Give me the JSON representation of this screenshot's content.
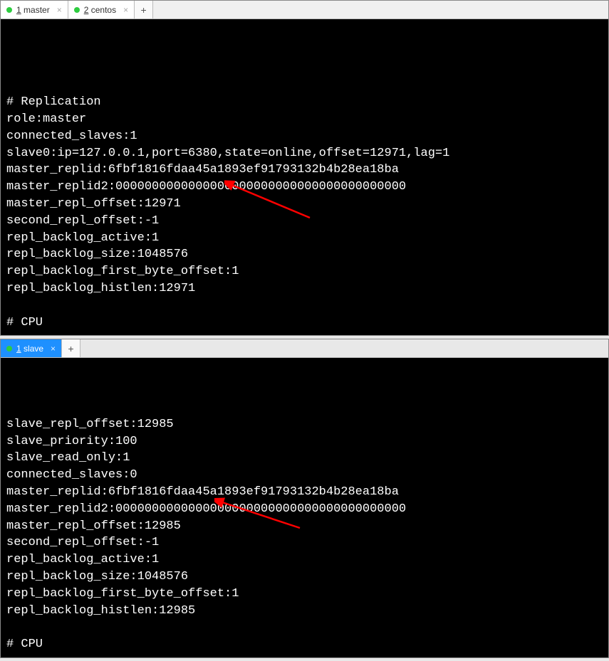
{
  "top": {
    "tabs": [
      {
        "label": "1 master"
      },
      {
        "label": "2 centos"
      }
    ],
    "terminal_lines": [
      "",
      "# Replication",
      "role:master",
      "connected_slaves:1",
      "slave0:ip=127.0.0.1,port=6380,state=online,offset=12971,lag=1",
      "master_replid:6fbf1816fdaa45a1893ef91793132b4b28ea18ba",
      "master_replid2:0000000000000000000000000000000000000000",
      "master_repl_offset:12971",
      "second_repl_offset:-1",
      "repl_backlog_active:1",
      "repl_backlog_size:1048576",
      "repl_backlog_first_byte_offset:1",
      "repl_backlog_histlen:12971",
      "",
      "# CPU"
    ]
  },
  "bottom": {
    "tabs": [
      {
        "label": "1 slave"
      }
    ],
    "terminal_lines": [
      "slave_repl_offset:12985",
      "slave_priority:100",
      "slave_read_only:1",
      "connected_slaves:0",
      "master_replid:6fbf1816fdaa45a1893ef91793132b4b28ea18ba",
      "master_replid2:0000000000000000000000000000000000000000",
      "master_repl_offset:12985",
      "second_repl_offset:-1",
      "repl_backlog_active:1",
      "repl_backlog_size:1048576",
      "repl_backlog_first_byte_offset:1",
      "repl_backlog_histlen:12985",
      "",
      "# CPU"
    ]
  },
  "glyphs": {
    "close": "×",
    "plus": "+"
  }
}
